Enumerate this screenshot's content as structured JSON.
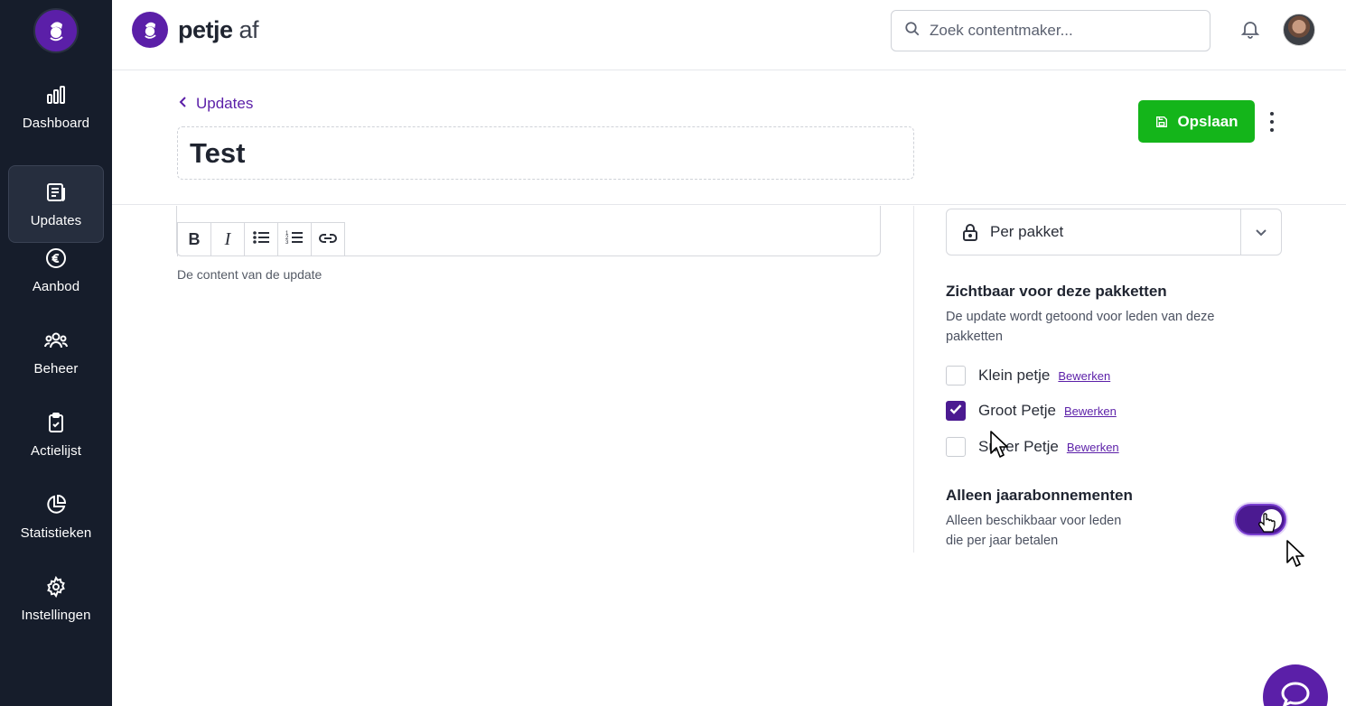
{
  "brand": {
    "name_bold": "petje",
    "name_light": " af",
    "color": "#5b1fa8"
  },
  "sidebar": {
    "items": [
      {
        "label": "Dashboard",
        "icon": "bar-chart-icon"
      },
      {
        "label": "Updates",
        "icon": "newspaper-icon",
        "active": true
      },
      {
        "label": "Aanbod",
        "icon": "euro-icon"
      },
      {
        "label": "Beheer",
        "icon": "users-icon"
      },
      {
        "label": "Actielijst",
        "icon": "clipboard-check-icon"
      },
      {
        "label": "Statistieken",
        "icon": "pie-chart-icon"
      },
      {
        "label": "Instellingen",
        "icon": "gear-icon"
      }
    ]
  },
  "header": {
    "search_placeholder": "Zoek contentmaker..."
  },
  "page": {
    "back_label": "Updates",
    "title": "Test",
    "save_label": "Opslaan",
    "save_color": "#14b51a"
  },
  "editor": {
    "toolbar": [
      "bold",
      "italic",
      "bullet-list",
      "numbered-list",
      "link"
    ],
    "content_placeholder": "De content van de update"
  },
  "visibility": {
    "select_value": "Per pakket",
    "packages_title": "Zichtbaar voor deze pakketten",
    "packages_desc_line1": "De update wordt getoond voor leden van deze",
    "packages_desc_line2": "pakketten",
    "packages": [
      {
        "name": "Klein petje",
        "edit": "Bewerken",
        "checked": false
      },
      {
        "name": "Groot Petje",
        "edit": "Bewerken",
        "checked": true
      },
      {
        "name": "Super Petje",
        "edit": "Bewerken",
        "checked": false
      }
    ],
    "yearly_title": "Alleen jaarabonnementen",
    "yearly_desc_line1": "Alleen beschikbaar voor leden",
    "yearly_desc_line2": "die per jaar betalen",
    "yearly_enabled": true
  }
}
